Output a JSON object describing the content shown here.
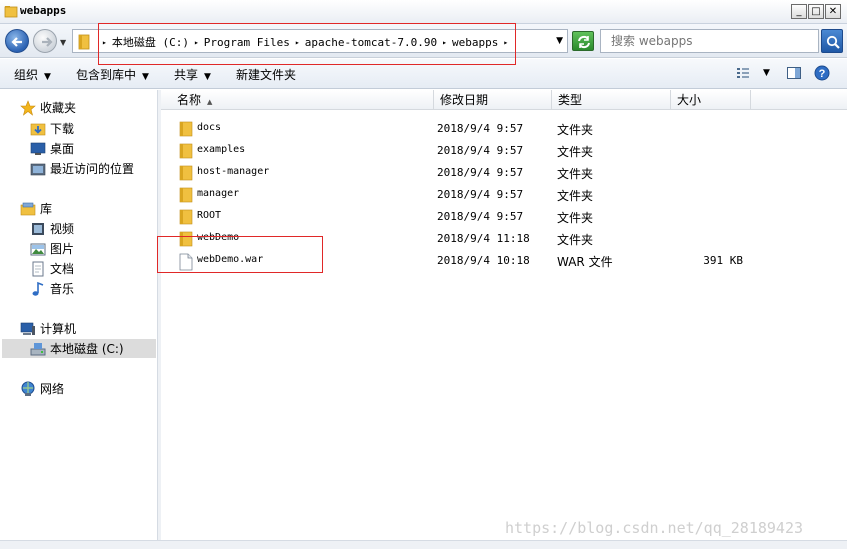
{
  "window": {
    "title": "webapps"
  },
  "address": {
    "crumbs": [
      "本地磁盘 (C:)",
      "Program Files",
      "apache-tomcat-7.0.90",
      "webapps"
    ]
  },
  "search": {
    "placeholder": "搜索 webapps"
  },
  "toolbar": {
    "organize": "组织",
    "include_in_library": "包含到库中",
    "share": "共享",
    "new_folder": "新建文件夹"
  },
  "sidebar": {
    "favorites": "收藏夹",
    "downloads": "下载",
    "desktop": "桌面",
    "recent": "最近访问的位置",
    "libraries": "库",
    "videos": "视频",
    "pictures": "图片",
    "documents": "文档",
    "music": "音乐",
    "computer": "计算机",
    "local_disk": "本地磁盘 (C:)",
    "network": "网络"
  },
  "columns": {
    "name": "名称",
    "date": "修改日期",
    "type": "类型",
    "size": "大小"
  },
  "files": [
    {
      "name": "docs",
      "date": "2018/9/4 9:57",
      "type": "文件夹",
      "size": ""
    },
    {
      "name": "examples",
      "date": "2018/9/4 9:57",
      "type": "文件夹",
      "size": ""
    },
    {
      "name": "host-manager",
      "date": "2018/9/4 9:57",
      "type": "文件夹",
      "size": ""
    },
    {
      "name": "manager",
      "date": "2018/9/4 9:57",
      "type": "文件夹",
      "size": ""
    },
    {
      "name": "ROOT",
      "date": "2018/9/4 9:57",
      "type": "文件夹",
      "size": ""
    },
    {
      "name": "webDemo",
      "date": "2018/9/4 11:18",
      "type": "文件夹",
      "size": ""
    },
    {
      "name": "webDemo.war",
      "date": "2018/9/4 10:18",
      "type": "WAR 文件",
      "size": "391 KB"
    }
  ],
  "watermark": "https://blog.csdn.net/qq_28189423",
  "colors": {
    "annotation_red": "#e02828",
    "folder_yellow": "#f0c040"
  }
}
